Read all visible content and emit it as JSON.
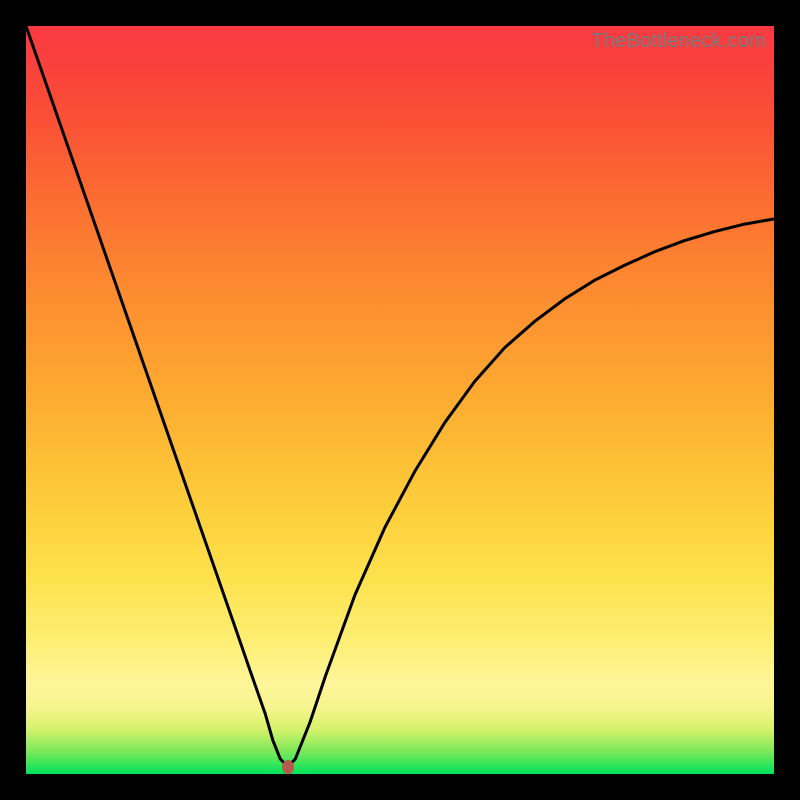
{
  "attribution": "TheBottleneck.com",
  "colors": {
    "curve": "#000000",
    "marker": "#b55a4e",
    "gradient_top": "#fa3942",
    "gradient_bottom": "#00e35b",
    "frame": "#000000"
  },
  "chart_data": {
    "type": "line",
    "title": "",
    "xlabel": "",
    "ylabel": "",
    "xlim": [
      0,
      100
    ],
    "ylim": [
      0,
      100
    ],
    "grid": false,
    "legend": false,
    "annotations": [],
    "series": [
      {
        "name": "bottleneck-curve",
        "x": [
          0,
          4,
          8,
          12,
          16,
          20,
          24,
          28,
          30,
          32,
          33,
          34,
          35,
          36,
          38,
          40,
          44,
          48,
          52,
          56,
          60,
          64,
          68,
          72,
          76,
          80,
          84,
          88,
          92,
          96,
          100
        ],
        "y": [
          100,
          88.5,
          77,
          65.5,
          54,
          42.5,
          31,
          19.5,
          13.7,
          8,
          4.5,
          2,
          1,
          2,
          7,
          13,
          24,
          33,
          40.5,
          47,
          52.5,
          57,
          60.5,
          63.5,
          66,
          68,
          69.8,
          71.3,
          72.5,
          73.5,
          74.2
        ]
      }
    ],
    "marker": {
      "x": 35,
      "y": 1
    }
  }
}
